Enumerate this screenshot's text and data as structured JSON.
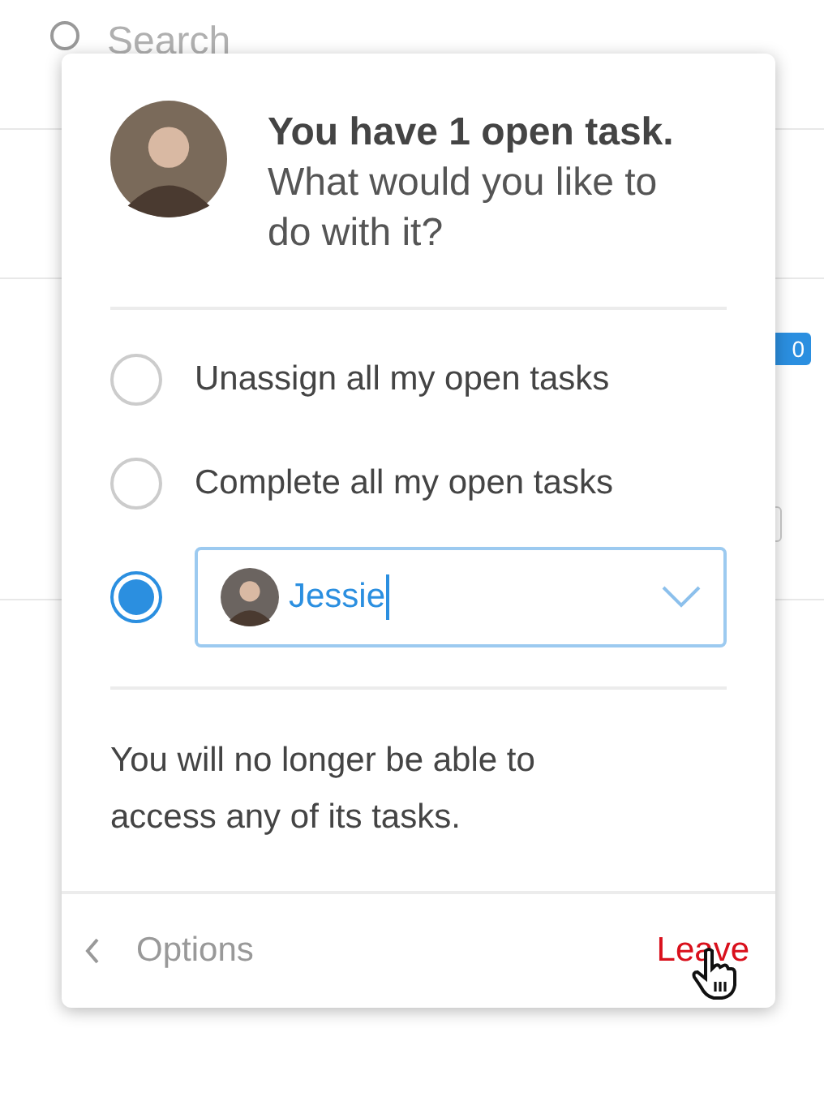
{
  "background": {
    "search": {
      "placeholder": "Search"
    },
    "badge": "0"
  },
  "dialog": {
    "heading": "You have 1 open task.",
    "question": "What would you like to do with it?",
    "options": [
      {
        "kind": "radio",
        "label": "Unassign all my open tasks",
        "selected": false
      },
      {
        "kind": "radio",
        "label": "Complete all my open tasks",
        "selected": false
      },
      {
        "kind": "assignee",
        "value": "Jessie",
        "selected": true
      }
    ],
    "note": "You will no longer be able to access any of its tasks.",
    "back": "Options",
    "leave": "Leave"
  }
}
